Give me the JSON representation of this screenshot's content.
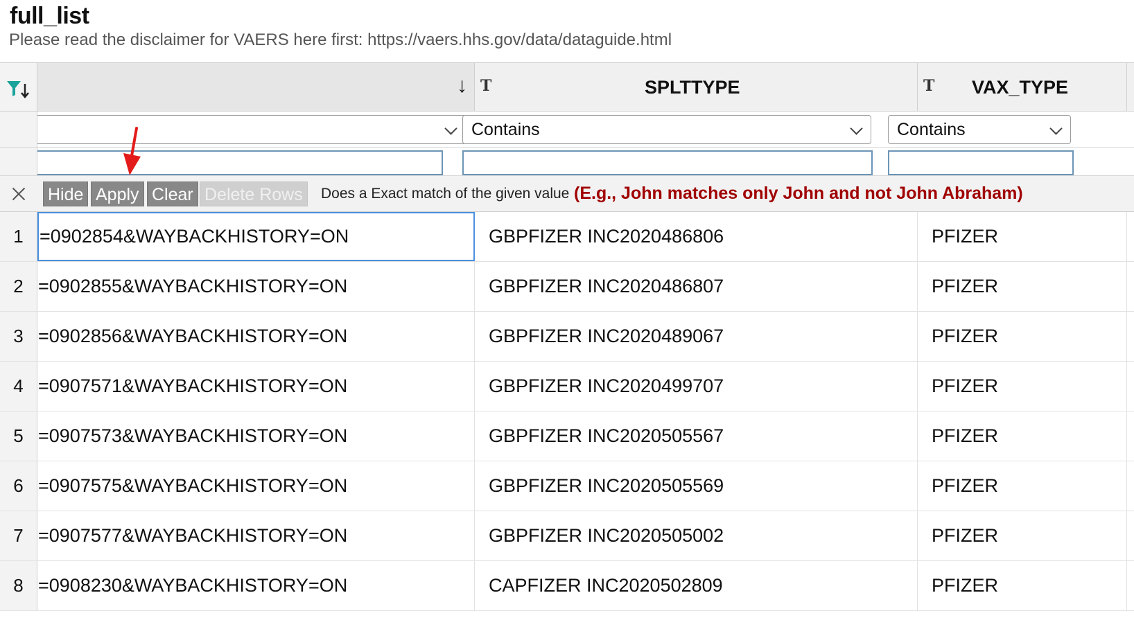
{
  "page": {
    "title": "full_list",
    "subtitle": "Please read the disclaimer for VAERS here first: https://vaers.hhs.gov/data/dataguide.html"
  },
  "columns": [
    {
      "name": "",
      "sort": "descending"
    },
    {
      "name": "SPLTTYPE",
      "type_glyph": "T"
    },
    {
      "name": "VAX_TYPE",
      "type_glyph": "T"
    }
  ],
  "filter": {
    "operators": [
      "",
      "Contains",
      "Contains"
    ],
    "values": [
      "",
      "",
      ""
    ]
  },
  "actions": {
    "hide": "Hide",
    "apply": "Apply",
    "clear": "Clear",
    "delete_rows": "Delete Rows",
    "hint": "Does a Exact match of the given value",
    "example": "(E.g., John matches only John and not John Abraham)"
  },
  "rows": [
    {
      "n": "1",
      "c1": "=0902854&WAYBACKHISTORY=ON",
      "c2": "GBPFIZER INC2020486806",
      "c3": "PFIZER"
    },
    {
      "n": "2",
      "c1": "=0902855&WAYBACKHISTORY=ON",
      "c2": "GBPFIZER INC2020486807",
      "c3": "PFIZER"
    },
    {
      "n": "3",
      "c1": "=0902856&WAYBACKHISTORY=ON",
      "c2": "GBPFIZER INC2020489067",
      "c3": "PFIZER"
    },
    {
      "n": "4",
      "c1": "=0907571&WAYBACKHISTORY=ON",
      "c2": "GBPFIZER INC2020499707",
      "c3": "PFIZER"
    },
    {
      "n": "5",
      "c1": "=0907573&WAYBACKHISTORY=ON",
      "c2": "GBPFIZER INC2020505567",
      "c3": "PFIZER"
    },
    {
      "n": "6",
      "c1": "=0907575&WAYBACKHISTORY=ON",
      "c2": "GBPFIZER INC2020505569",
      "c3": "PFIZER"
    },
    {
      "n": "7",
      "c1": "=0907577&WAYBACKHISTORY=ON",
      "c2": "GBPFIZER INC2020505002",
      "c3": "PFIZER"
    },
    {
      "n": "8",
      "c1": "=0908230&WAYBACKHISTORY=ON",
      "c2": "CAPFIZER INC2020502809",
      "c3": "PFIZER"
    }
  ],
  "colors": {
    "accent_red": "#a00000",
    "selection_blue": "#4a8fe0",
    "filter_icon_teal": "#1aa39a",
    "annotation_red": "#e31b1b"
  },
  "icons": {
    "filter": "filter-sort-icon",
    "sort": "sort-down-arrow-icon",
    "type": "text-type-icon",
    "close": "close-icon",
    "dropdown": "chevron-down-icon"
  }
}
